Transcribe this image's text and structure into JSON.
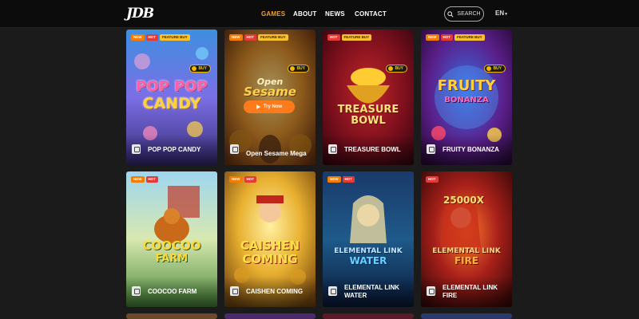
{
  "header": {
    "logo": "JDB",
    "nav": [
      {
        "label": "GAMES",
        "active": true
      },
      {
        "label": "ABOUT",
        "active": false
      },
      {
        "label": "NEWS",
        "active": false
      },
      {
        "label": "CONTACT",
        "active": false
      }
    ],
    "search_label": "SEARCH",
    "language": "EN"
  },
  "badge_labels": {
    "new": "NEW",
    "hot": "HOT",
    "feature": "FEATURE BUY"
  },
  "buy_label": "BUY",
  "try_now_label": "Try Now",
  "games": [
    {
      "name": "POP POP CANDY",
      "logo": [
        "POP POP",
        "CANDY"
      ],
      "badges": [
        "new",
        "hot",
        "feature"
      ],
      "buy": true
    },
    {
      "name": "Open Sesame Mega",
      "logo": [
        "Open",
        "Sesame"
      ],
      "badges": [
        "new",
        "hot",
        "feature"
      ],
      "buy": true,
      "hovered": true
    },
    {
      "name": "TREASURE BOWL",
      "logo": [
        "TREASURE",
        "BOWL"
      ],
      "badges": [
        "hot",
        "feature"
      ],
      "buy": true
    },
    {
      "name": "FRUITY BONANZA",
      "logo": [
        "FRUITY",
        "BONANZA"
      ],
      "badges": [
        "new",
        "hot",
        "feature"
      ],
      "buy": true
    },
    {
      "name": "COOCOO FARM",
      "logo": [
        "COOCOO",
        "FARM"
      ],
      "badges": [
        "new",
        "hot"
      ],
      "buy": false
    },
    {
      "name": "CAISHEN COMING",
      "logo": [
        "CAISHEN",
        "COMING"
      ],
      "badges": [
        "new",
        "hot"
      ],
      "buy": false
    },
    {
      "name": "ELEMENTAL LINK WATER",
      "logo": [
        "ELEMENTAL LINK",
        "WATER"
      ],
      "badges": [
        "new",
        "hot"
      ],
      "buy": false
    },
    {
      "name": "ELEMENTAL LINK FIRE",
      "logo": [
        "ELEMENTAL LINK",
        "FIRE"
      ],
      "badges": [
        "hot"
      ],
      "buy": false,
      "extra": "25000X"
    }
  ],
  "colors": {
    "accent": "#f0a030",
    "background": "#1b1b1b",
    "header": "#0c0c0c"
  }
}
